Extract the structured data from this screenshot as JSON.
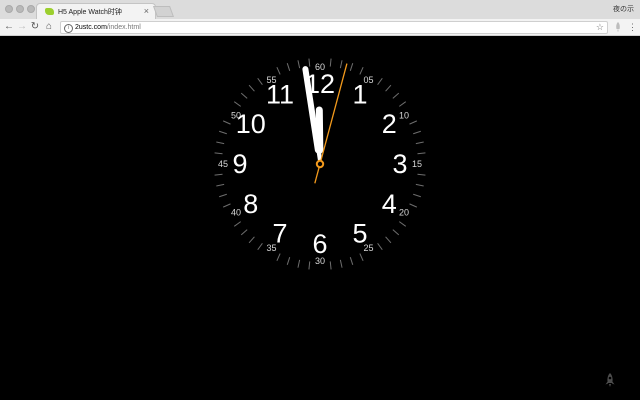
{
  "browser": {
    "tab_title": "H5 Apple Watch时钟",
    "tab_close": "×",
    "profile": "夜の示",
    "url_host": "2ustc.com",
    "url_path": "/index.html",
    "back_glyph": "←",
    "forward_glyph": "→",
    "reload_glyph": "↻",
    "home_glyph": "⌂",
    "star_glyph": "☆",
    "menu_glyph": "⋮",
    "info_glyph": "i"
  },
  "clock": {
    "hour_numerals": [
      "12",
      "1",
      "2",
      "3",
      "4",
      "5",
      "6",
      "7",
      "8",
      "9",
      "10",
      "11"
    ],
    "minute_labels": [
      "60",
      "05",
      "10",
      "15",
      "20",
      "25",
      "30",
      "35",
      "40",
      "45",
      "50",
      "55"
    ],
    "time": {
      "hours": 11,
      "minutes": 58.5,
      "seconds": 2.5
    },
    "colors": {
      "background": "#000000",
      "numerals": "#ffffff",
      "minute_labels": "#d8d8d8",
      "ticks": "#6e6e6e",
      "hands": "#ffffff",
      "second_hand": "#f39a1c"
    }
  }
}
